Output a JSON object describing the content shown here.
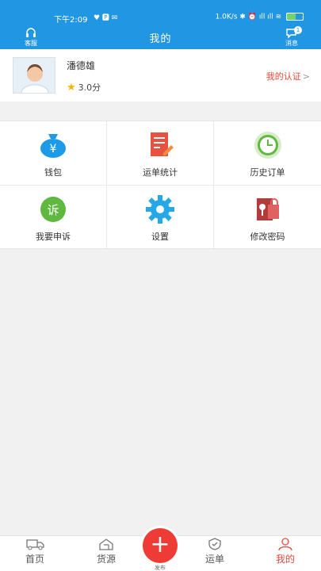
{
  "status_bar": {
    "time": "下午2:09",
    "left_badges": "♥ 🅿 ✉",
    "right_indicators": "1.0K/s ✱ ⏰ ıll ıll ≋",
    "battery_level": 0.55
  },
  "header": {
    "title": "我的",
    "left_button_label": "客服",
    "right_button_label": "消息",
    "message_badge": "1"
  },
  "profile": {
    "name": "潘德雄",
    "rating": "3.0分",
    "certify_label": "我的认证",
    "chevron": ">"
  },
  "menu": [
    {
      "label": "钱包",
      "icon": "wallet-icon",
      "color": "#1e9be8",
      "glyph": "¥"
    },
    {
      "label": "运单统计",
      "icon": "report-icon",
      "color": "#e8513f"
    },
    {
      "label": "历史订单",
      "icon": "clock-icon",
      "color": "#5fb83f"
    },
    {
      "label": "我要申诉",
      "icon": "complaint-icon",
      "color": "#5fb83f",
      "glyph": "诉"
    },
    {
      "label": "设置",
      "icon": "gear-icon",
      "color": "#27a8e6"
    },
    {
      "label": "修改密码",
      "icon": "lock-icon",
      "color": "#b23b3b"
    }
  ],
  "tabbar": {
    "items": [
      "首页",
      "货源",
      "运单",
      "我的"
    ],
    "publish_label": "发布",
    "publish_glyph": "+",
    "active_index": 3,
    "active_color": "#e24a3b"
  }
}
